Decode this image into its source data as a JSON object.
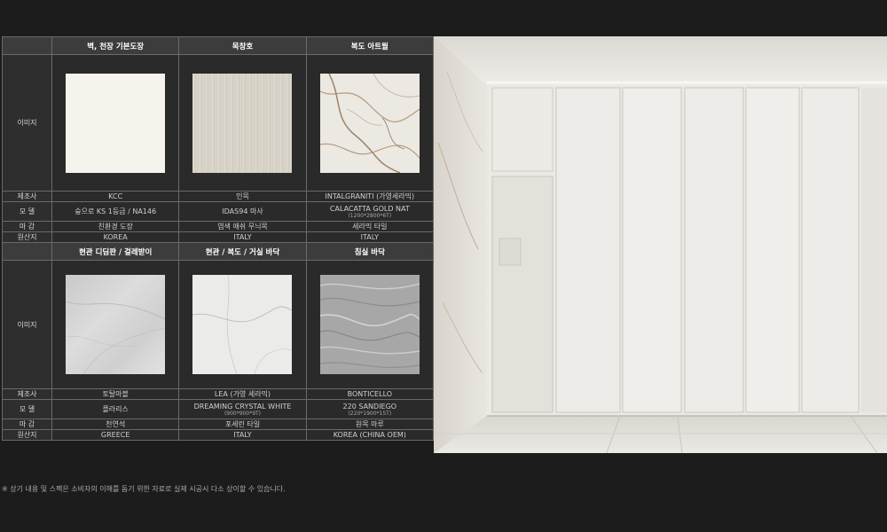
{
  "row_labels": {
    "image": "이미지",
    "manufacturer": "제조사",
    "model": "모 델",
    "finish": "마 감",
    "origin": "원산지"
  },
  "section1": {
    "headers": [
      "벽, 천장 기본도장",
      "목창호",
      "복도 아트월"
    ],
    "manufacturer": [
      "KCC",
      "인목",
      "INTALGRANITI (가영세라믹)"
    ],
    "model": [
      "숲으로 KS 1등급 / NA146",
      "IDAS94 마사",
      "CALACATTA GOLD NAT"
    ],
    "model_sub": [
      "",
      "",
      "(1200*2800*6T)"
    ],
    "finish": [
      "친환경 도장",
      "염색 애쉬 무늬목",
      "세라믹 타일"
    ],
    "origin": [
      "KOREA",
      "ITALY",
      "ITALY"
    ]
  },
  "section2": {
    "headers": [
      "현관 디딤판 / 걸레받이",
      "현관 / 복도 / 거실 바닥",
      "침실 바닥"
    ],
    "manufacturer": [
      "토탈마블",
      "LEA (가영 세라믹)",
      "BONTICELLO"
    ],
    "model": [
      "플라리스",
      "DREAMING CRYSTAL WHITE",
      "220 SANDIEGO"
    ],
    "model_sub": [
      "",
      "(900*900*9T)",
      "(220*1900*15T)"
    ],
    "finish": [
      "천연석",
      "포세린 타일",
      "원목 마루"
    ],
    "origin": [
      "GREECE",
      "ITALY",
      "KOREA (CHINA OEM)"
    ]
  },
  "footnote": "※ 상기 내용 및 스펙은 소비자의 이해를 돕기 위한 자료로 실제 시공시 다소 상이할 수 있습니다."
}
